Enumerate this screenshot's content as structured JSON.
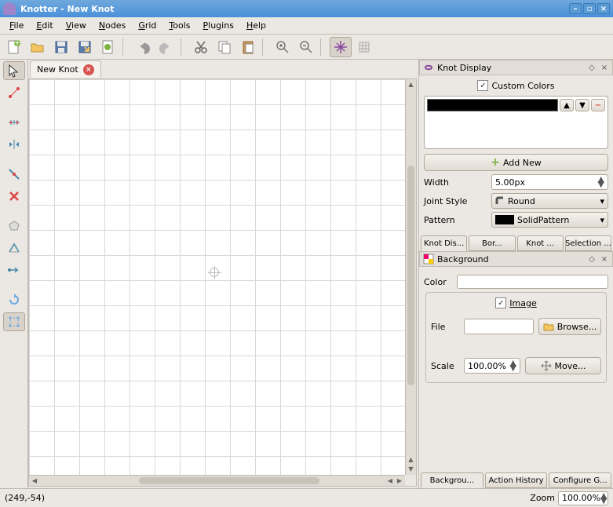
{
  "title": "Knotter - New Knot",
  "menus": {
    "file": "File",
    "edit": "Edit",
    "view": "View",
    "nodes": "Nodes",
    "grid": "Grid",
    "tools": "Tools",
    "plugins": "Plugins",
    "help": "Help"
  },
  "tab": {
    "label": "New Knot"
  },
  "knot_display": {
    "title": "Knot Display",
    "custom_colors": "Custom Colors",
    "add_new": "Add New",
    "width_label": "Width",
    "width_value": "5.00px",
    "joint_label": "Joint Style",
    "joint_value": "Round",
    "pattern_label": "Pattern",
    "pattern_value": "SolidPattern"
  },
  "tabs1": {
    "knot": "Knot Dis...",
    "borders": "Bor...",
    "knot2": "Knot ...",
    "selection": "Selection ..."
  },
  "background": {
    "title": "Background",
    "color_label": "Color",
    "image_label": "Image",
    "file_label": "File",
    "browse": "Browse...",
    "scale_label": "Scale",
    "scale_value": "100.00%",
    "move": "Move..."
  },
  "tabs2": {
    "bg": "Backgrou...",
    "history": "Action History",
    "config": "Configure G..."
  },
  "status": {
    "coords": "(249,-54)",
    "zoom_label": "Zoom",
    "zoom_value": "100.00%"
  }
}
